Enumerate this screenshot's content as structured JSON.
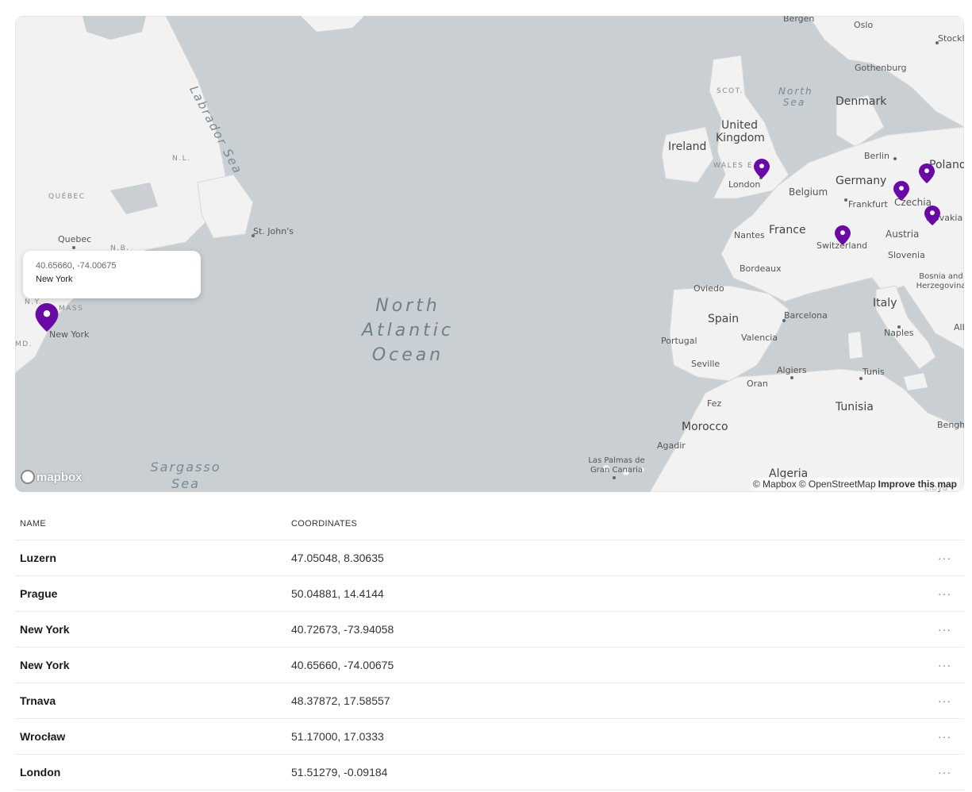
{
  "map": {
    "labels": {
      "labrador_sea": "Labrador Sea",
      "north_sea": "North Sea",
      "north_atlantic": "North Atlantic Ocean",
      "sargasso": "Sargasso Sea",
      "scot": "SCOT.",
      "wales": "WALES E",
      "nl": "N.L.",
      "quebec_prov": "QUÉBEC",
      "ny_abbr": "N.Y.",
      "mass": "MASS",
      "md": "MD.",
      "nb": "N.B.",
      "uk": "United Kingdom",
      "ireland": "Ireland",
      "london": "London",
      "france": "France",
      "nantes": "Nantes",
      "bordeaux": "Bordeaux",
      "belgium": "Belgium",
      "germany": "Germany",
      "berlin": "Berlin",
      "frankfurt": "Frankfurt",
      "czechia": "Czechia",
      "poland": "Poland",
      "slovakia": "Slovakia",
      "austria": "Austria",
      "switzerland": "Switzerland",
      "slovenia": "Slovenia",
      "bosnia": "Bosnia and Herzegovina",
      "italy": "Italy",
      "naples": "Naples",
      "albania": "Alban",
      "spain": "Spain",
      "portugal": "Portugal",
      "oviedo": "Oviedo",
      "barcelona": "Barcelona",
      "valencia": "Valencia",
      "seville": "Seville",
      "algiers": "Algiers",
      "oran": "Oran",
      "tunis": "Tunis",
      "tunisia": "Tunisia",
      "fez": "Fez",
      "morocco": "Morocco",
      "agadir": "Agadir",
      "las_palmas": "Las Palmas de Gran Canaria",
      "algeria": "Algeria",
      "benghazi": "Bengh",
      "libya": "Libya",
      "denmark": "Denmark",
      "oslo": "Oslo",
      "bergen": "Bergen",
      "gothenburg": "Gothenburg",
      "stockholm": "Stockl",
      "quebec": "Quebec",
      "st_johns": "St. John's",
      "new_york": "New York"
    },
    "popup": {
      "coords": "40.65660, -74.00675",
      "name": "New York"
    },
    "logo": "mapbox",
    "attribution": {
      "mapbox": "© Mapbox",
      "osm": "© OpenStreetMap",
      "improve": "Improve this map"
    },
    "marker_color": "#6a0aa6"
  },
  "table": {
    "headers": {
      "name": "NAME",
      "coordinates": "COORDINATES"
    },
    "actions_glyph": "···",
    "rows": [
      {
        "name": "Luzern",
        "coords": "47.05048, 8.30635"
      },
      {
        "name": "Prague",
        "coords": "50.04881, 14.4144"
      },
      {
        "name": "New York",
        "coords": "40.72673, -73.94058"
      },
      {
        "name": "New York",
        "coords": "40.65660, -74.00675"
      },
      {
        "name": "Trnava",
        "coords": "48.37872, 17.58557"
      },
      {
        "name": "Wrocław",
        "coords": "51.17000, 17.0333"
      },
      {
        "name": "London",
        "coords": "51.51279, -0.09184"
      }
    ]
  }
}
